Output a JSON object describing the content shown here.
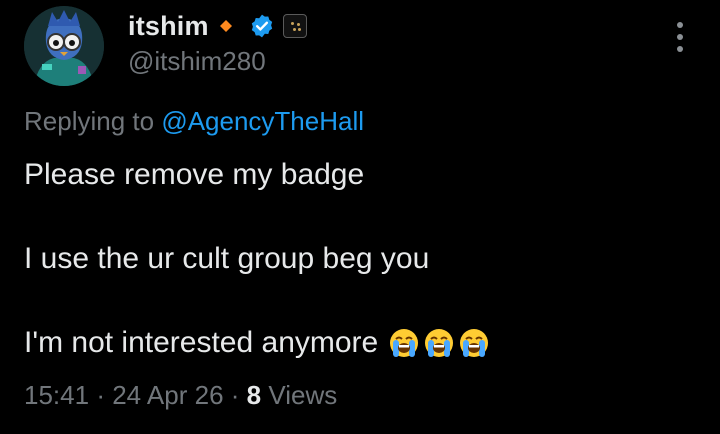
{
  "user": {
    "display_name": "itshim",
    "handle": "@itshim280"
  },
  "reply": {
    "prefix": "Replying to",
    "mention": "@AgencyTheHall"
  },
  "body": {
    "line1": "Please remove my badge",
    "line2": "I use the ur cult group beg you",
    "line3": "I'm not interested anymore",
    "emojis": [
      "loudly-crying-face",
      "loudly-crying-face",
      "loudly-crying-face"
    ]
  },
  "meta": {
    "time": "15:41",
    "sep1": "·",
    "date": "24 Apr 26",
    "sep2": "·",
    "views_count": "8",
    "views_label": "Views"
  },
  "colors": {
    "background": "#000000",
    "text": "#e7e9ea",
    "muted": "#71767b",
    "link": "#1d9bf0",
    "verified": "#1d9bf0",
    "orange_badge": "#ff8a1f"
  }
}
